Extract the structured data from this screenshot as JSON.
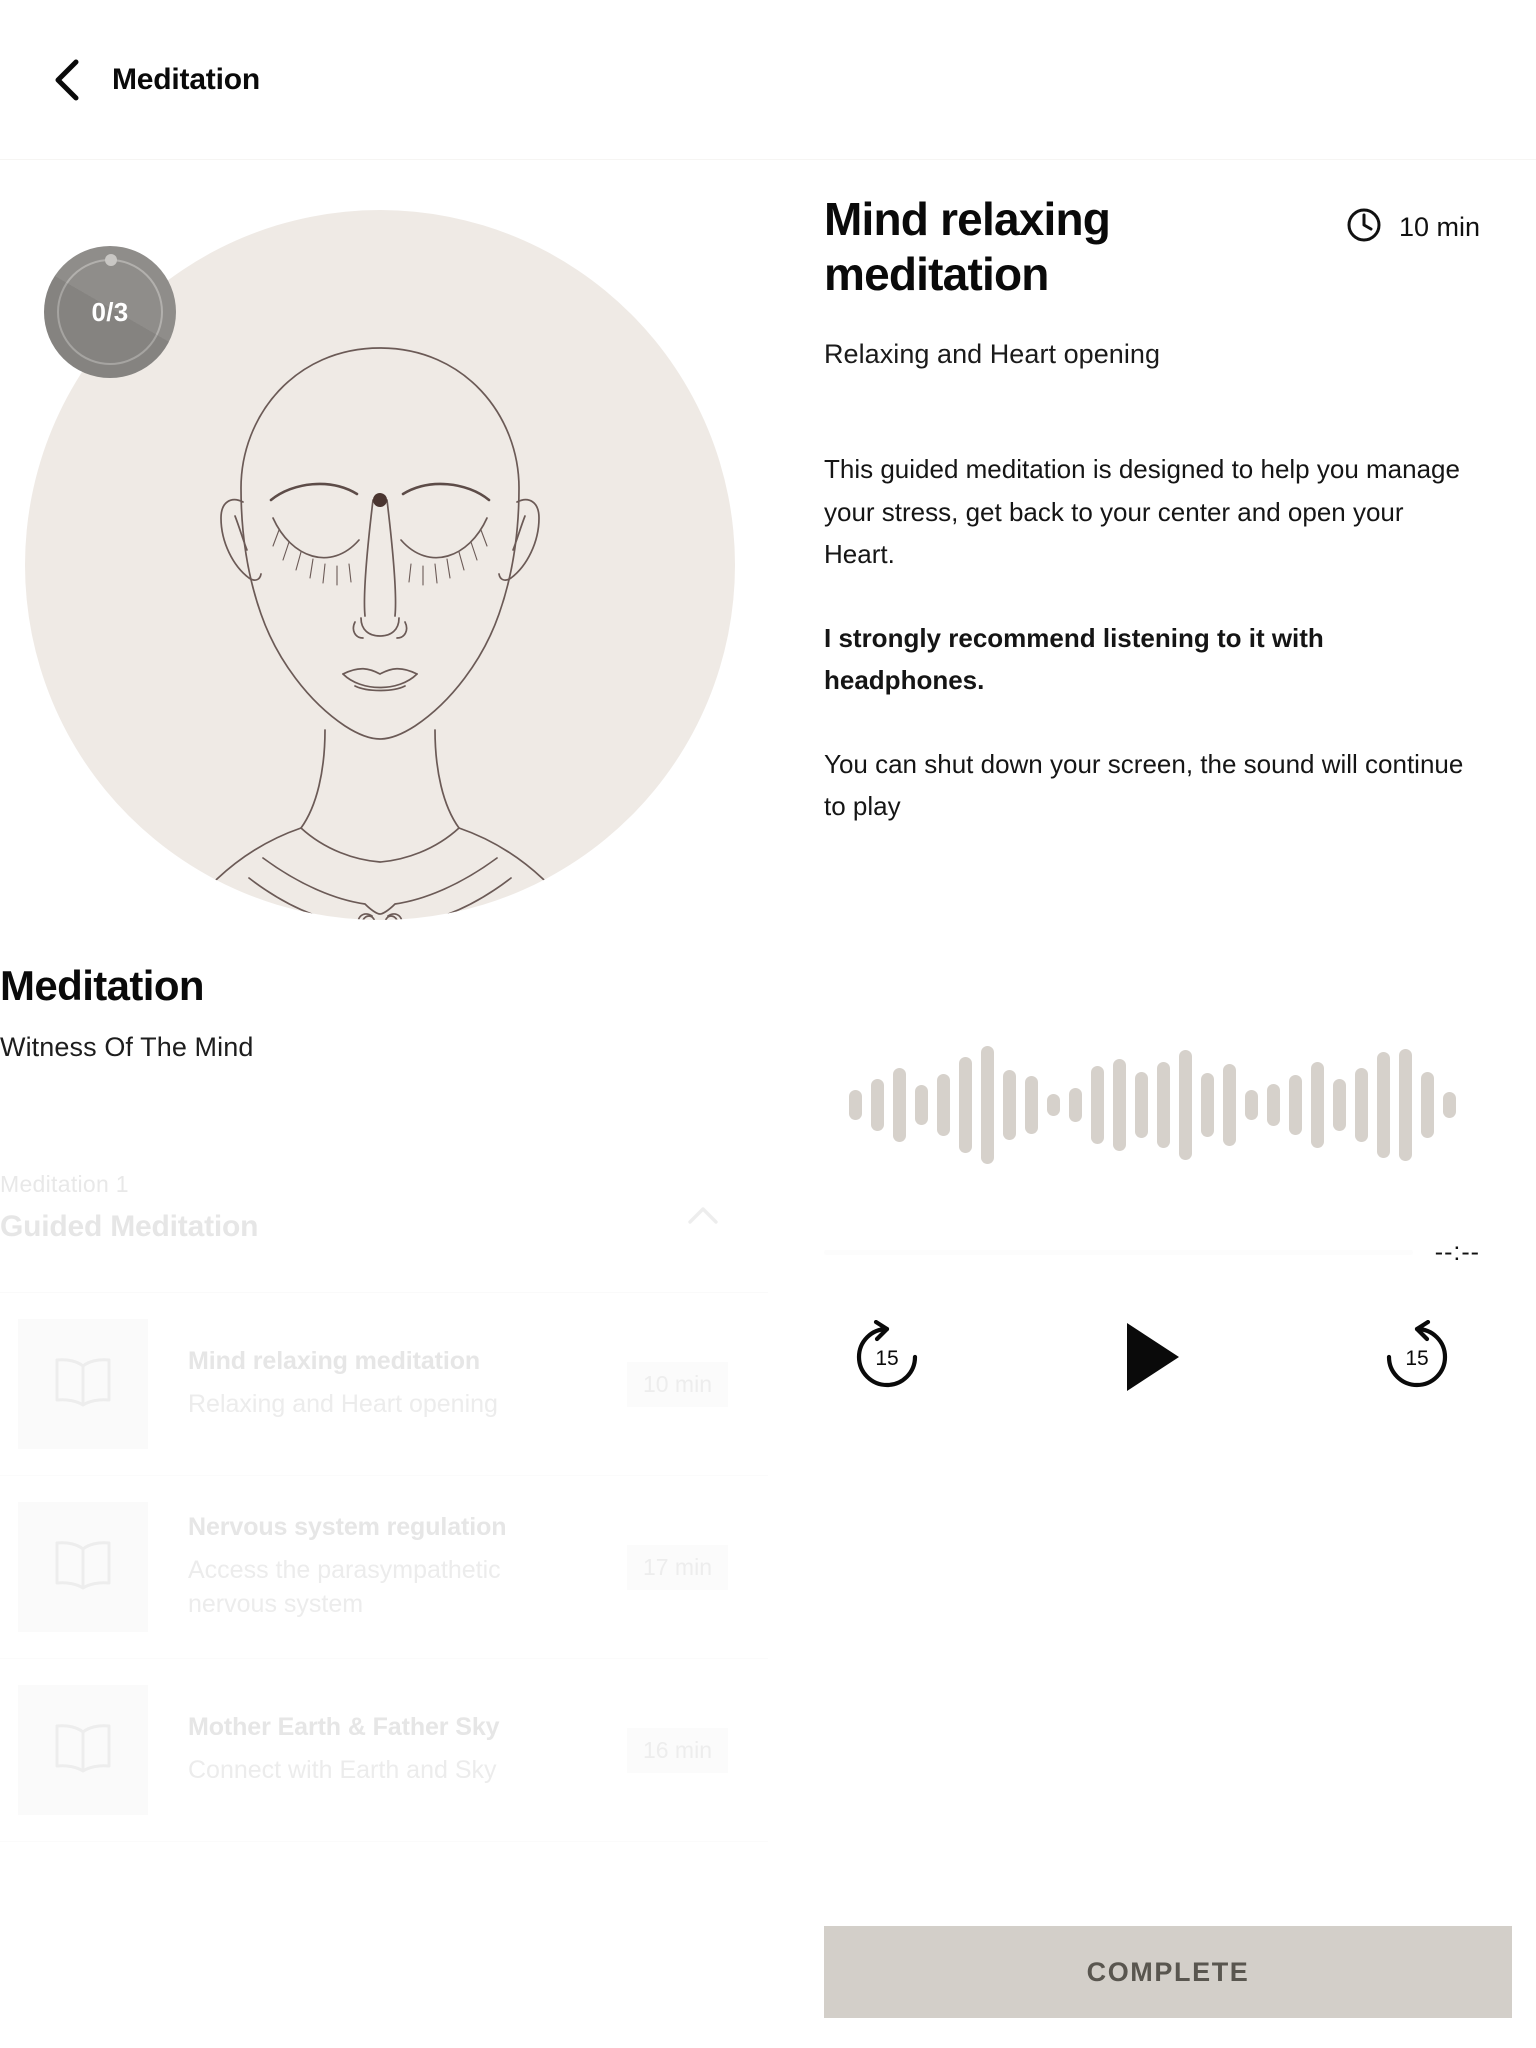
{
  "header": {
    "back_icon": "chevron-left-icon",
    "title": "Meditation"
  },
  "hero": {
    "progress_label": "0/3",
    "illustration": "meditating-face-namaste-illustration",
    "circle_color": "#efeae5",
    "badge_color": "#8f8d8a"
  },
  "left": {
    "section_title": "Meditation",
    "section_subtitle": "Witness Of The Mind",
    "playlist": {
      "kicker": "Meditation  1",
      "title": "Guided Meditation",
      "collapse_icon": "chevron-up-icon",
      "tracks": [
        {
          "icon": "book-icon",
          "title": "Mind relaxing meditation",
          "subtitle": "Relaxing and Heart opening",
          "duration": "10 min"
        },
        {
          "icon": "book-icon",
          "title": "Nervous system regulation",
          "subtitle": "Access the parasympathetic nervous system",
          "duration": "17 min"
        },
        {
          "icon": "book-icon",
          "title": "Mother Earth & Father Sky",
          "subtitle": "Connect with Earth and Sky",
          "duration": "16 min"
        }
      ]
    }
  },
  "detail": {
    "title": "Mind relaxing meditation",
    "duration_icon": "clock-icon",
    "duration": "10 min",
    "subtitle": "Relaxing and Heart opening",
    "paragraph_1": "This guided meditation is designed to help you manage your stress, get back to your center and open your Heart.",
    "paragraph_2": "I strongly recommend listening to it with headphones.",
    "paragraph_3": "You can shut down your screen, the sound will continue to play"
  },
  "player": {
    "waveform_icon": "audio-waveform-icon",
    "waveform_color": "#d6d1cb",
    "waveform_bars": [
      30,
      52,
      74,
      40,
      62,
      96,
      118,
      70,
      58,
      22,
      34,
      78,
      92,
      66,
      86,
      110,
      64,
      82,
      30,
      42,
      60,
      86,
      52,
      74,
      106,
      112,
      66,
      26
    ],
    "progress_percent": 0,
    "time_remaining": "--:--",
    "rewind_icon": "replay-15-icon",
    "rewind_label": "15",
    "play_icon": "play-icon",
    "forward_icon": "forward-15-icon",
    "forward_label": "15"
  },
  "footer": {
    "complete_label": "COMPLETE",
    "complete_bg": "#d3cfc9",
    "complete_text_color": "#59564f"
  }
}
